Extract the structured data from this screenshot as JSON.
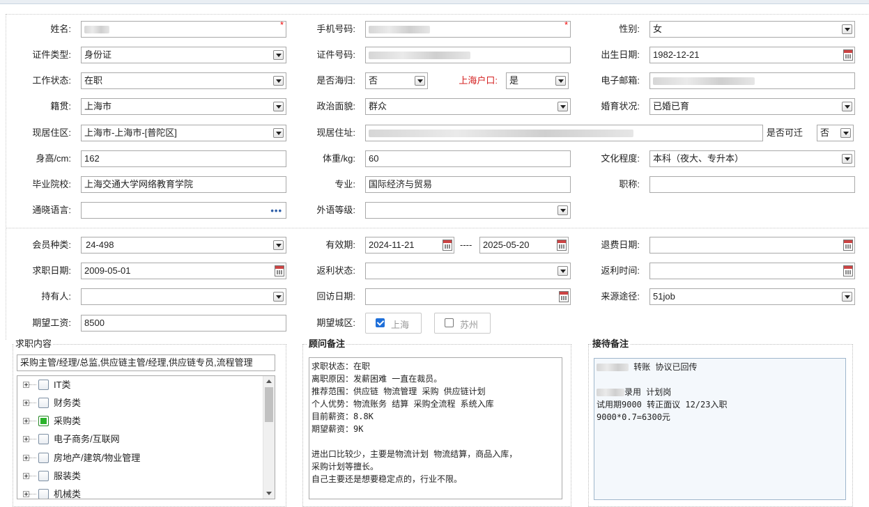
{
  "labels": {
    "name": "姓名:",
    "phone": "手机号码:",
    "gender": "性别:",
    "id_type": "证件类型:",
    "id_number": "证件号码:",
    "birth_date": "出生日期:",
    "work_status": "工作状态:",
    "overseas": "是否海归:",
    "shanghai_hukou": "上海户口:",
    "email": "电子邮箱:",
    "native_place": "籍贯:",
    "political": "政治面貌:",
    "marital": "婚育状况:",
    "current_area": "现居住区:",
    "current_address": "现居住址:",
    "relocate": "是否可迁",
    "height": "身高/cm:",
    "weight": "体重/kg:",
    "education": "文化程度:",
    "school": "毕业院校:",
    "major": "专业:",
    "title": "职称:",
    "language": "通晓语言:",
    "foreign_level": "外语等级:",
    "member_type": "会员种类:",
    "valid_period": "有效期:",
    "refund_date": "退费日期:",
    "job_date": "求职日期:",
    "rebate_status": "返利状态:",
    "rebate_time": "返利时间:",
    "holder": "持有人:",
    "revisit_date": "回访日期:",
    "source": "来源途径:",
    "expected_salary": "期望工资:",
    "expected_city": "期望城区:"
  },
  "values": {
    "gender": "女",
    "id_type": "身份证",
    "birth_date": "1982-12-21",
    "work_status": "在职",
    "overseas": "否",
    "shanghai_hukou": "是",
    "native_place": "上海市",
    "political": "群众",
    "marital": "已婚已育",
    "current_area": "上海市-上海市-[普陀区]",
    "relocate": "否",
    "height": "162",
    "weight": "60",
    "education": "本科（夜大、专升本）",
    "school": "上海交通大学网络教育学院",
    "major": "国际经济与贸易",
    "title": "",
    "language": "",
    "foreign_level": "",
    "member_type": "24-498",
    "valid_from": "2024-11-21",
    "valid_sep": "----",
    "valid_to": "2025-05-20",
    "refund_date": "",
    "job_date": "2009-05-01",
    "rebate_status": "",
    "rebate_time": "",
    "holder": "",
    "revisit_date": "",
    "source": "51job",
    "expected_salary": "8500",
    "required_mark": "*",
    "lang_button": "•••"
  },
  "cities": [
    {
      "label": "上海",
      "checked": true
    },
    {
      "label": "苏州",
      "checked": false
    }
  ],
  "job_panel": {
    "title": "求职内容",
    "summary": "采购主管/经理/总监,供应链主管/经理,供应链专员,流程管理",
    "tree": [
      {
        "label": "IT类",
        "checked": false
      },
      {
        "label": "财务类",
        "checked": false
      },
      {
        "label": "采购类",
        "checked": true
      },
      {
        "label": "电子商务/互联网",
        "checked": false
      },
      {
        "label": "房地产/建筑/物业管理",
        "checked": false
      },
      {
        "label": "服装类",
        "checked": false
      },
      {
        "label": "机械类",
        "checked": false
      }
    ]
  },
  "advisor_panel": {
    "title": "顾问备注",
    "text": "求职状态：在职\n离职原因：发薪困难 一直在裁员。\n推荐范围：供应链 物流管理 采购 供应链计划\n个人优势：物流账务 结算 采购全流程 系统入库\n目前薪资：8.8K\n期望薪资：9K\n\n进出口比较少，主要是物流计划 物流结算，商品入库，\n采购计划等擅长。\n自己主要还是想要稳定点的，行业不限。"
  },
  "reception_panel": {
    "title": "接待备注",
    "line1": "转账 协议已回传",
    "line2": "录用 计划岗",
    "line3": "试用期9000 转正面议 12/23入职",
    "line4": "9000*0.7=6300元"
  }
}
